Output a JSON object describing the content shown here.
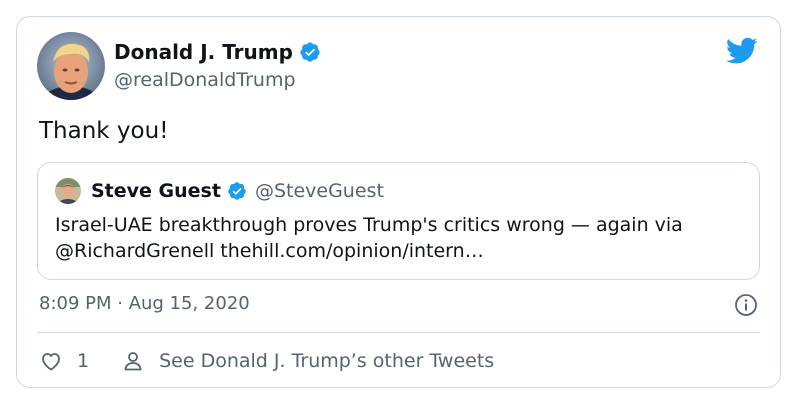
{
  "tweet": {
    "author_name": "Donald J. Trump",
    "author_handle": "@realDonaldTrump",
    "text": "Thank you!",
    "timestamp": "8:09 PM · Aug 15, 2020"
  },
  "quoted": {
    "author_name": "Steve Guest",
    "author_handle": "@SteveGuest",
    "text_line1": "Israel-UAE breakthrough proves Trump's critics wrong — again via",
    "text_line2": "@RichardGrenell thehill.com/opinion/intern…"
  },
  "footer": {
    "like_count": "1",
    "other_tweets_label": "See Donald J. Trump’s other Tweets"
  },
  "colors": {
    "twitter_blue": "#1d9bf0",
    "secondary_text": "#536471",
    "border": "#cfd9de"
  },
  "icons": [
    "twitter-bird-icon",
    "verified-badge-icon",
    "info-icon",
    "heart-icon",
    "person-icon"
  ]
}
